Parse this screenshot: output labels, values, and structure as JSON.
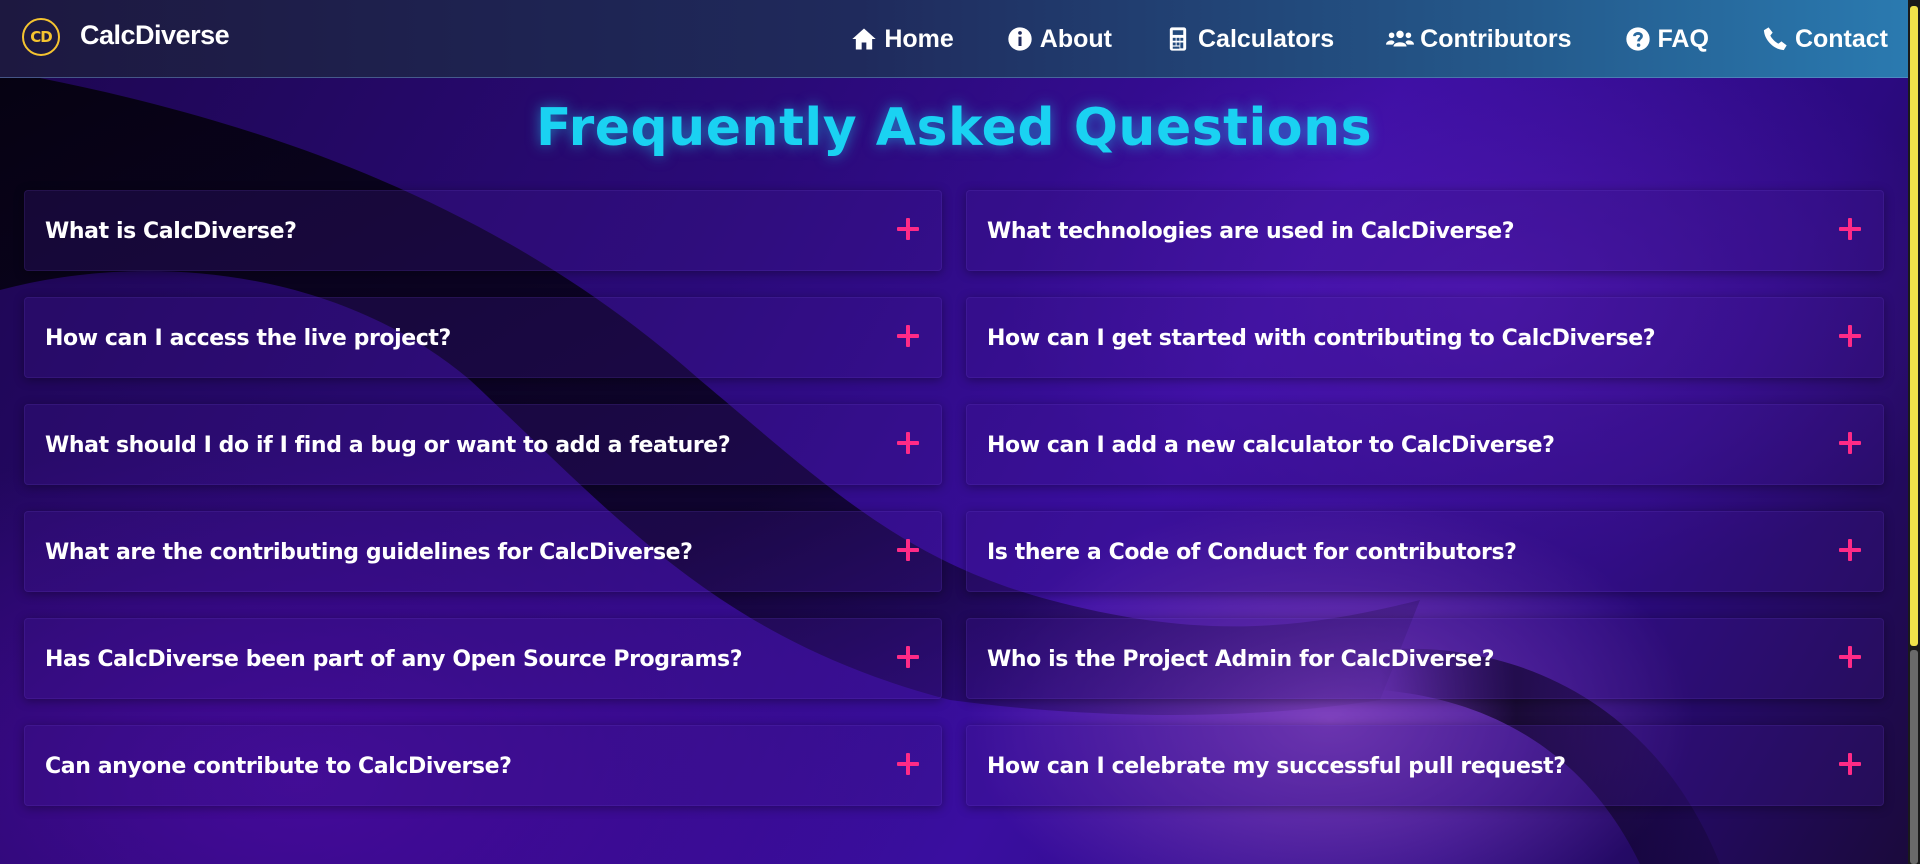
{
  "header": {
    "logo_text": "CD",
    "brand": "CalcDiverse",
    "nav": [
      {
        "label": "Home",
        "icon": "home-icon"
      },
      {
        "label": "About",
        "icon": "info-icon"
      },
      {
        "label": "Calculators",
        "icon": "calculator-icon"
      },
      {
        "label": "Contributors",
        "icon": "users-icon"
      },
      {
        "label": "FAQ",
        "icon": "question-icon"
      },
      {
        "label": "Contact",
        "icon": "phone-icon"
      }
    ]
  },
  "main": {
    "title": "Frequently Asked Questions",
    "faqs": [
      "What is CalcDiverse?",
      "What technologies are used in CalcDiverse?",
      "How can I access the live project?",
      "How can I get started with contributing to CalcDiverse?",
      "What should I do if I find a bug or want to add a feature?",
      "How can I add a new calculator to CalcDiverse?",
      "What are the contributing guidelines for CalcDiverse?",
      "Is there a Code of Conduct for contributors?",
      "Has CalcDiverse been part of any Open Source Programs?",
      "Who is the Project Admin for CalcDiverse?",
      "Can anyone contribute to CalcDiverse?",
      "How can I celebrate my successful pull request?"
    ]
  },
  "colors": {
    "title": "#1ad2f2",
    "toggle": "#ff2a86",
    "logo": "#f5c430",
    "scroll_thumb": "#f0e34a"
  }
}
